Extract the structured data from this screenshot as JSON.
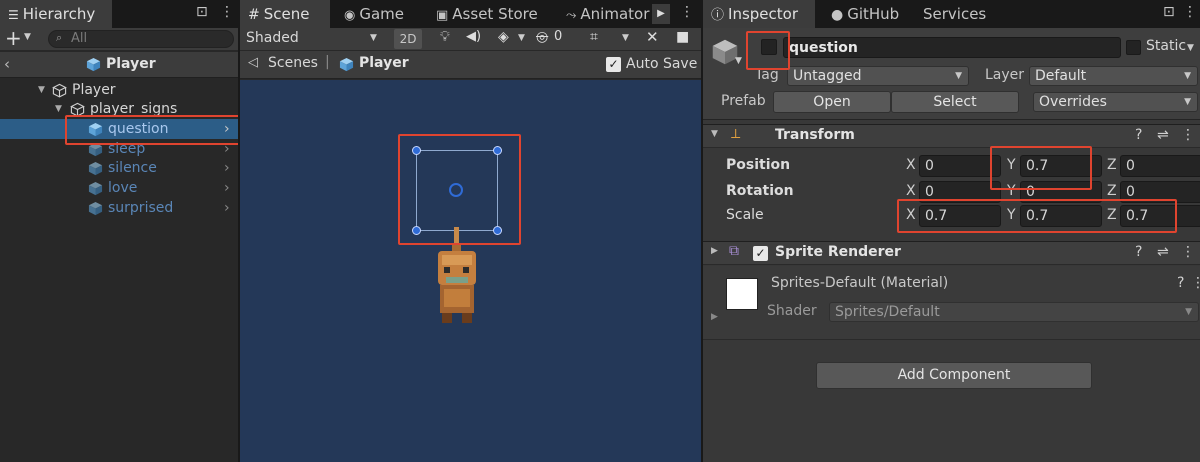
{
  "hierarchy": {
    "tab_label": "Hierarchy",
    "search_placeholder": "All",
    "prefab_title": "Player",
    "items": [
      {
        "label": "Player"
      },
      {
        "label": "player_signs"
      },
      {
        "label": "question"
      },
      {
        "label": "sleep"
      },
      {
        "label": "silence"
      },
      {
        "label": "love"
      },
      {
        "label": "surprised"
      }
    ]
  },
  "scene": {
    "tabs": [
      {
        "label": "Scene"
      },
      {
        "label": "Game"
      },
      {
        "label": "Asset Store"
      },
      {
        "label": "Animator"
      }
    ],
    "shading_mode": "Shaded",
    "mode_2d": "2D",
    "breadcrumb": {
      "root": "Scenes",
      "current": "Player"
    },
    "auto_save_label": "Auto Save",
    "auto_save_checked": true
  },
  "inspector": {
    "tabs": [
      {
        "label": "Inspector"
      },
      {
        "label": "GitHub"
      },
      {
        "label": "Services"
      }
    ],
    "object_name": "question",
    "object_active": false,
    "static_label": "Static",
    "tag_label": "Tag",
    "tag_value": "Untagged",
    "layer_label": "Layer",
    "layer_value": "Default",
    "prefab_label": "Prefab",
    "prefab_open": "Open",
    "prefab_select": "Select",
    "prefab_overrides": "Overrides",
    "transform": {
      "title": "Transform",
      "position": {
        "label": "Position",
        "x": "0",
        "y": "0.7",
        "z": "0"
      },
      "rotation": {
        "label": "Rotation",
        "x": "0",
        "y": "0",
        "z": "0"
      },
      "scale": {
        "label": "Scale",
        "x": "0.7",
        "y": "0.7",
        "z": "0.7"
      },
      "axis_x": "X",
      "axis_y": "Y",
      "axis_z": "Z"
    },
    "sprite_renderer": {
      "title": "Sprite Renderer",
      "enabled": true,
      "material_name": "Sprites-Default (Material)",
      "shader_label": "Shader",
      "shader_value": "Sprites/Default"
    },
    "add_component_label": "Add Component"
  },
  "colors": {
    "selection": "#2c5d87",
    "highlight": "#e0442f",
    "scene_bg": "#243858",
    "inactive_text": "#5a86b7"
  }
}
